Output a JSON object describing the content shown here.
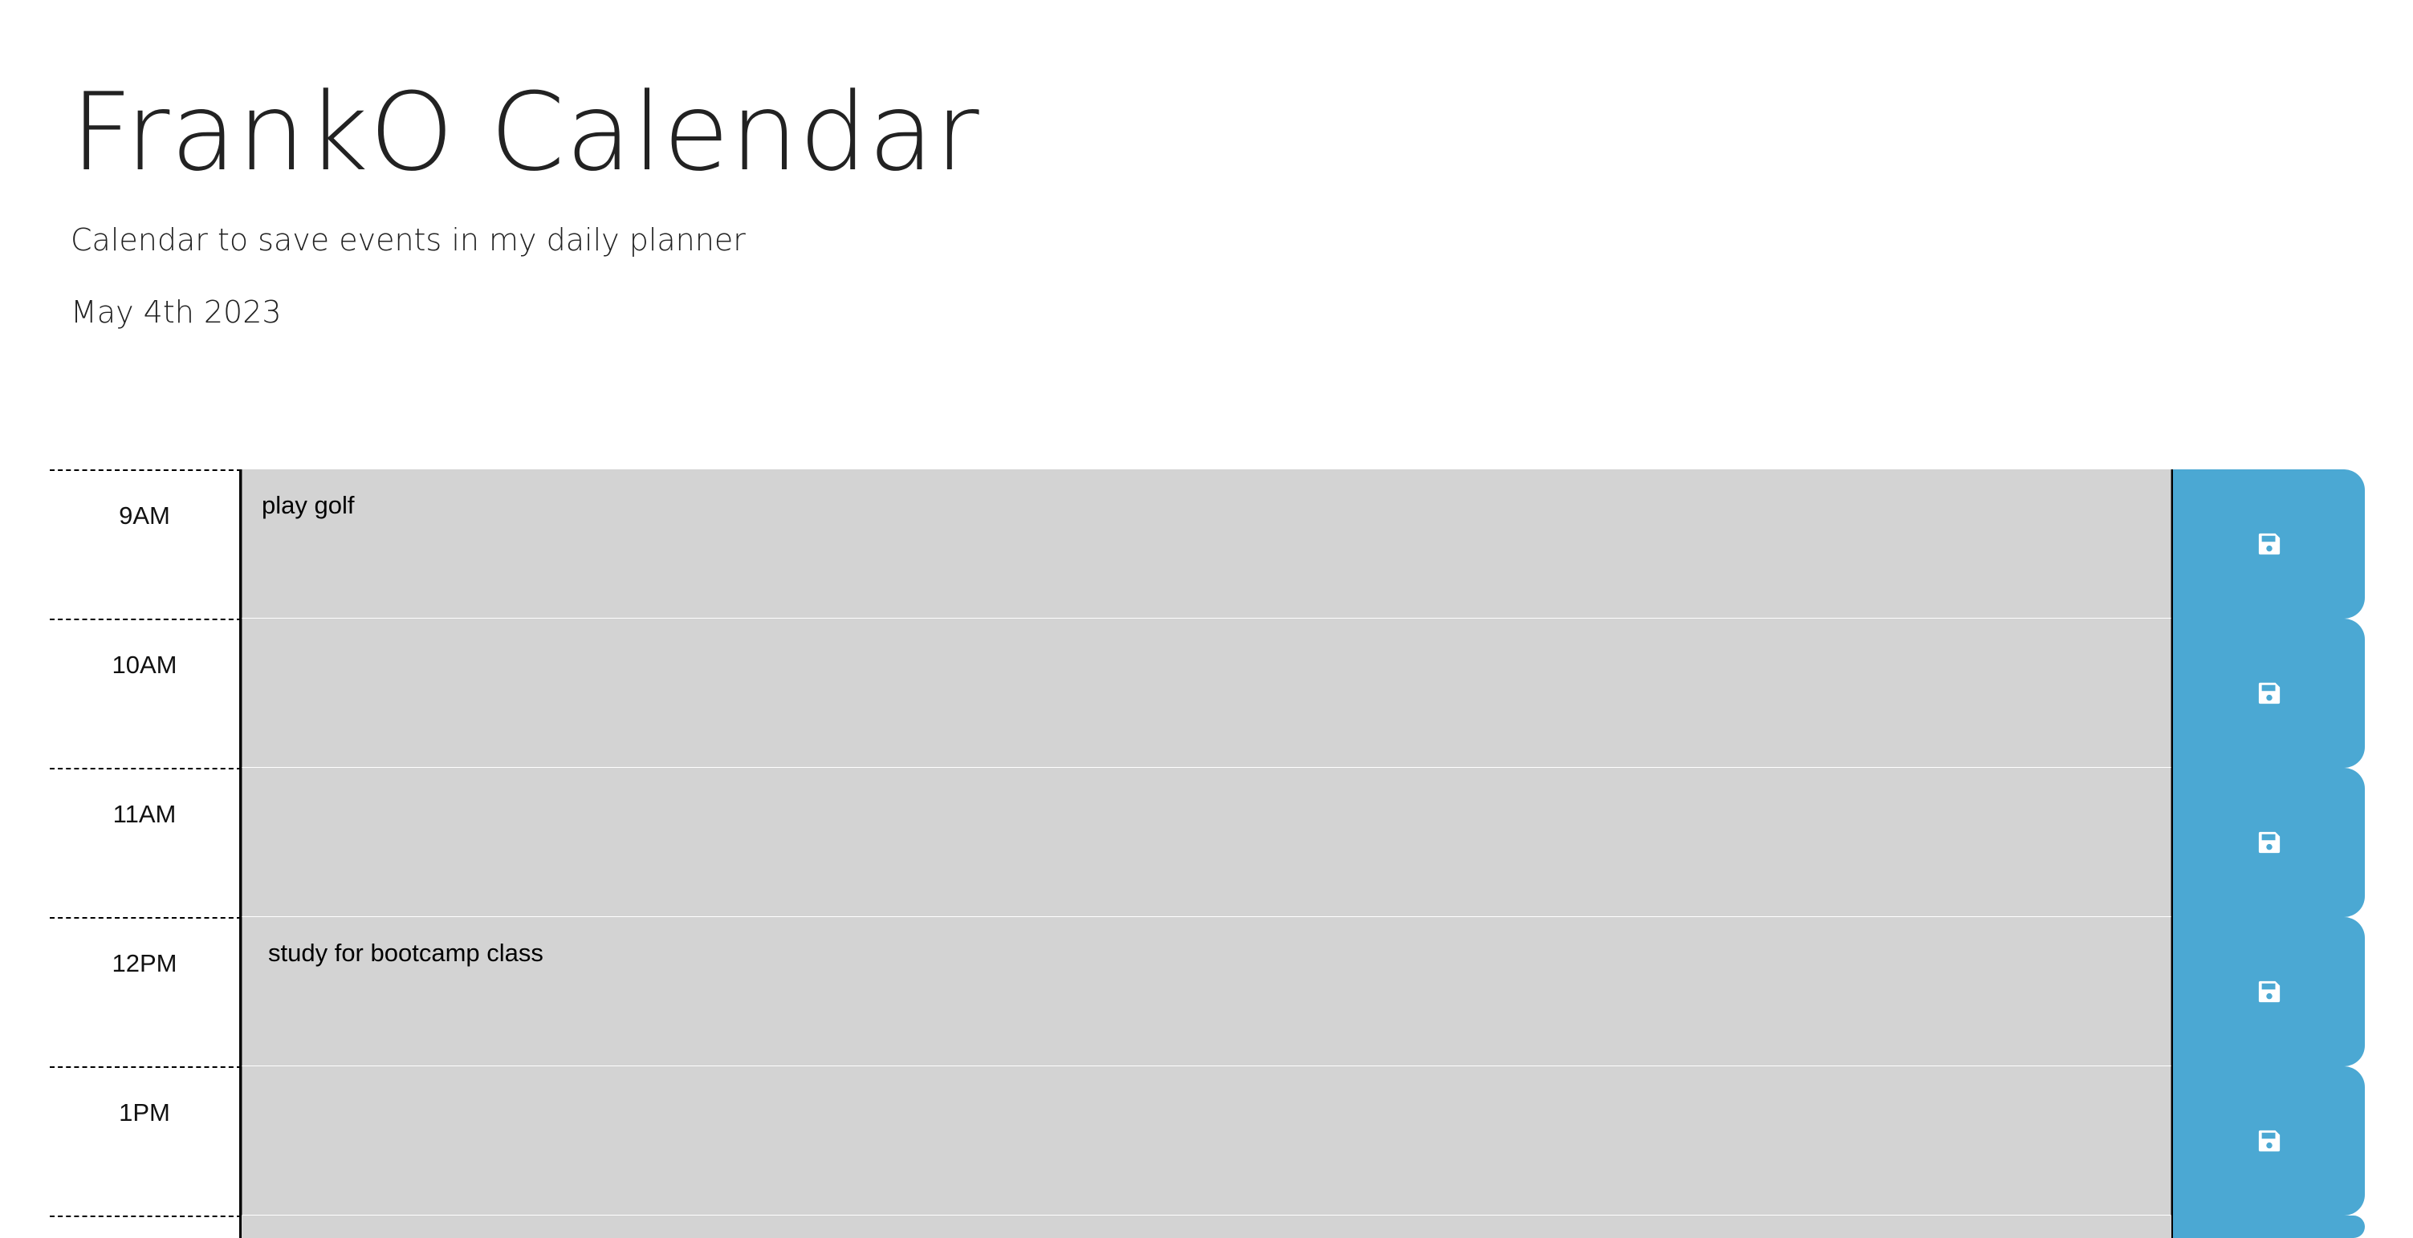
{
  "header": {
    "title": "FrankO Calendar",
    "lead": "Calendar to save events in my daily planner",
    "current_day": "May 4th 2023"
  },
  "colors": {
    "row_background": "#d3d3d3",
    "save_button": "#4ba8d3",
    "save_icon": "#ffffff"
  },
  "time_blocks": [
    {
      "hour": "9AM",
      "event": "play golf",
      "save_icon": "floppy-disk-icon"
    },
    {
      "hour": "10AM",
      "event": "",
      "save_icon": "floppy-disk-icon"
    },
    {
      "hour": "11AM",
      "event": "",
      "save_icon": "floppy-disk-icon"
    },
    {
      "hour": "12PM",
      "event": "study for bootcamp class",
      "save_icon": "floppy-disk-icon"
    },
    {
      "hour": "1PM",
      "event": "",
      "save_icon": "floppy-disk-icon"
    }
  ]
}
